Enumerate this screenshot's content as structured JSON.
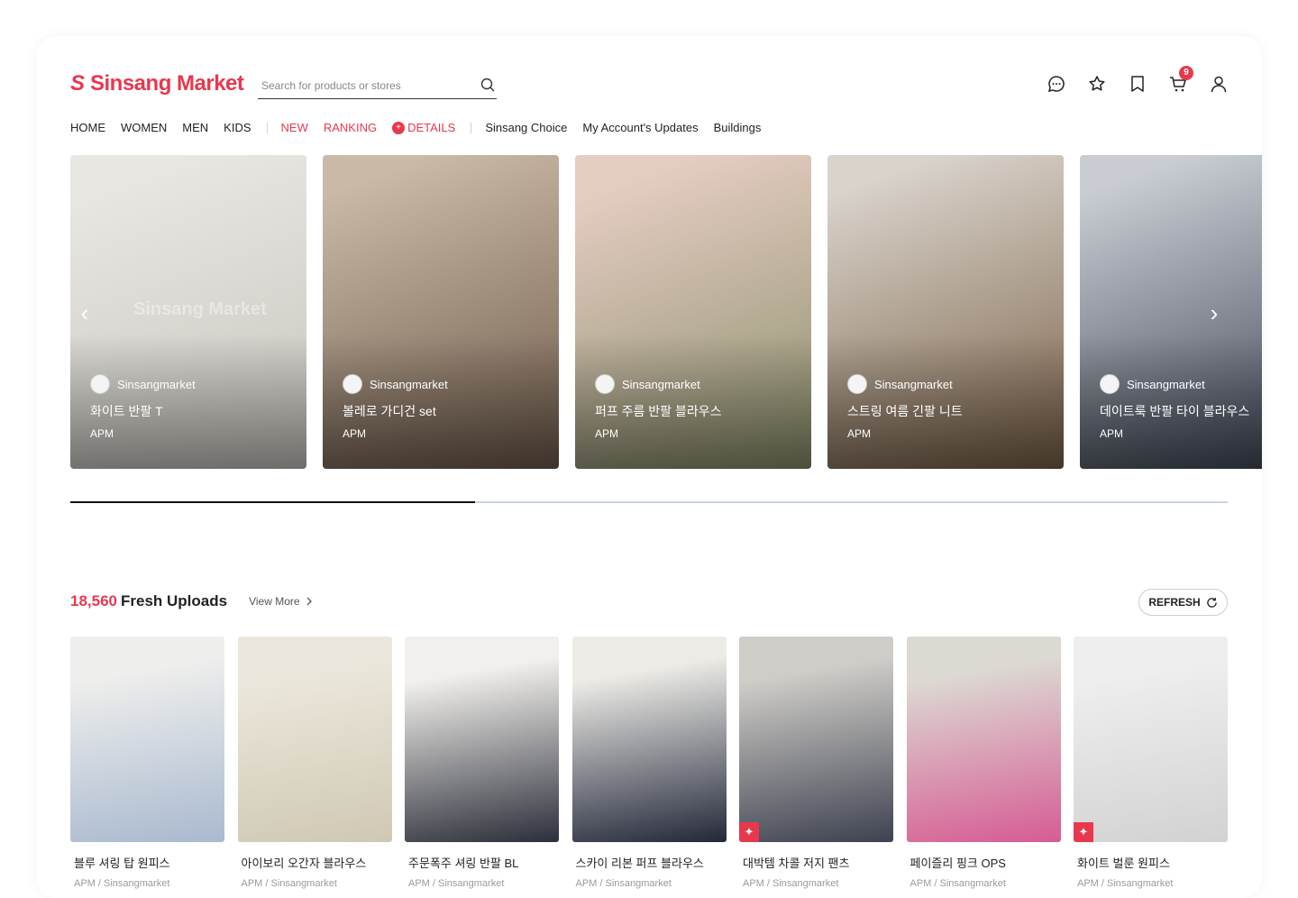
{
  "brand": {
    "name": "Sinsang Market",
    "color": "#e8384f"
  },
  "search": {
    "placeholder": "Search for products or stores",
    "icon": "search-icon"
  },
  "header_icons": [
    {
      "name": "chat-icon"
    },
    {
      "name": "star-icon"
    },
    {
      "name": "bookmark-icon"
    },
    {
      "name": "cart-icon",
      "badge": "9"
    },
    {
      "name": "user-icon"
    }
  ],
  "nav": {
    "main": [
      "HOME",
      "WOMEN",
      "MEN",
      "KIDS"
    ],
    "highlight": [
      "NEW",
      "RANKING",
      "DETAILS"
    ],
    "extra": [
      "Sinsang Choice",
      "My Account's Updates",
      "Buildings"
    ]
  },
  "hero": {
    "watermark": "Sinsang Market",
    "progress_fraction": 0.35,
    "cards": [
      {
        "store": "Sinsangmarket",
        "title": "화이트 반팔 T",
        "sub": "APM",
        "bg": [
          "#e9e7e2",
          "#c8c5be"
        ]
      },
      {
        "store": "Sinsangmarket",
        "title": "볼레로 가디건 set",
        "sub": "APM",
        "bg": [
          "#c9b9a6",
          "#6f5b4c"
        ]
      },
      {
        "store": "Sinsangmarket",
        "title": "퍼프 주름 반팔 블라우스",
        "sub": "APM",
        "bg": [
          "#e6cdc3",
          "#8b8f6c"
        ]
      },
      {
        "store": "Sinsangmarket",
        "title": "스트링 여름 긴팔 니트",
        "sub": "APM",
        "bg": [
          "#d9d3cb",
          "#7a6148"
        ]
      },
      {
        "store": "Sinsangmarket",
        "title": "데이트룩 반팔 타이 블라우스",
        "sub": "APM",
        "bg": [
          "#c9cdd3",
          "#3d4352"
        ]
      }
    ]
  },
  "fresh": {
    "count": "18,560",
    "title": "Fresh Uploads",
    "view_more": "View More",
    "refresh": "REFRESH",
    "products": [
      {
        "name": "블루 셔링 탑 원피스",
        "seller": "APM / Sinsangmarket",
        "bg": [
          "#eeeeec",
          "#a9b9cf"
        ],
        "badge": false
      },
      {
        "name": "아이보리 오간자 블라우스",
        "seller": "APM / Sinsangmarket",
        "bg": [
          "#ece7dc",
          "#cfc8b4"
        ],
        "badge": false
      },
      {
        "name": "주문폭주 셔링 반팔 BL",
        "seller": "APM / Sinsangmarket",
        "bg": [
          "#f2f0ec",
          "#2c2f3a"
        ],
        "badge": false
      },
      {
        "name": "스카이 리본 퍼프 블라우스",
        "seller": "APM / Sinsangmarket",
        "bg": [
          "#ecebe6",
          "#23283a"
        ],
        "badge": false
      },
      {
        "name": "대박템 차콜 저지 팬츠",
        "seller": "APM / Sinsangmarket",
        "bg": [
          "#cfcdc8",
          "#3e4250"
        ],
        "badge": true
      },
      {
        "name": "페이즐리 핑크 OPS",
        "seller": "APM / Sinsangmarket",
        "bg": [
          "#dcd9d3",
          "#d65c93"
        ],
        "badge": false
      },
      {
        "name": "화이트 벌룬 원피스",
        "seller": "APM / Sinsangmarket",
        "bg": [
          "#eeeeee",
          "#d2d2d2"
        ],
        "badge": true
      }
    ]
  }
}
